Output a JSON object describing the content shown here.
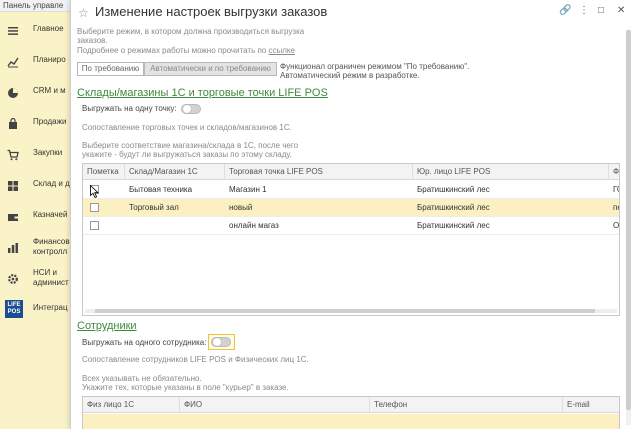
{
  "topbar": {
    "title": "Панель управле"
  },
  "sidebar": {
    "items": [
      {
        "label": "Главное",
        "icon": "menu-icon"
      },
      {
        "label": "Планиро",
        "icon": "chart-icon"
      },
      {
        "label": "CRM и м",
        "icon": "pie-icon"
      },
      {
        "label": "Продажи",
        "icon": "bag-icon"
      },
      {
        "label": "Закупки",
        "icon": "cart-icon"
      },
      {
        "label": "Склад и д",
        "icon": "grid-icon"
      },
      {
        "label": "Казначей",
        "icon": "wallet-icon"
      },
      {
        "label": "Финансов\nконтролл",
        "icon": "bar-chart-icon"
      },
      {
        "label": "НСИ и\nадминист",
        "icon": "gear-icon"
      },
      {
        "label": "Интеграц",
        "icon": "life-pos-logo"
      }
    ],
    "logo_text": "LIFE POS"
  },
  "modal": {
    "title": "Изменение настроек выгрузки заказов",
    "hint1_line1": "Выберите режим, в котором должна производиться выгрузка",
    "hint1_line2": "заказов.",
    "hint2_prefix": "Подробнее о режимах работы можно прочитать по ",
    "hint2_link": "ссылке",
    "mode_on_demand": "По требованию",
    "mode_auto": "Автоматически и по требованию",
    "mode_note_line1": "Функционал ограничен режимом \"По требованию\".",
    "mode_note_line2": "Автоматический режим в разработке."
  },
  "warehouses": {
    "section_title": "Склады/магазины 1С и торговые точки LIFE POS",
    "single_point_label": "Выгружать на одну точку:",
    "match_hint": "Сопоставление торговых точек и складов/магазинов 1С.",
    "select_hint_line1": "Выберите соответствие магазина/склада в 1С, после чего",
    "select_hint_line2": "укажите - будут ли выгружаться заказы по этому складу.",
    "columns": [
      "Пометка",
      "Склад/Магазин 1С",
      "Торговая точка LIFE POS",
      "Юр. лицо LIFE POS",
      "Фа"
    ],
    "rows": [
      {
        "store": "Бытовая техника",
        "point": "Магазин 1",
        "entity": "Братишкинский лес",
        "extra": "ГО"
      },
      {
        "store": "Торговый зал",
        "point": "новый",
        "entity": "Братишкинский лес",
        "extra": "пес"
      },
      {
        "store": "",
        "point": "онлайн магаз",
        "entity": "Братишкинский лес",
        "extra": "Он"
      }
    ]
  },
  "employees": {
    "section_title": "Сотрудники",
    "single_employee_label": "Выгружать на одного сотрудника:",
    "match_hint": "Сопоставление сотрудников LIFE POS и Физических лиц 1С.",
    "optional_hint_line1": "Всех указывать не обязательно.",
    "optional_hint_line2": "Укажите тех, которые указаны в поле \"курьер\" в заказе.",
    "columns": [
      "Физ лицо 1С",
      "ФИО",
      "Телефон",
      "E-mail"
    ]
  }
}
